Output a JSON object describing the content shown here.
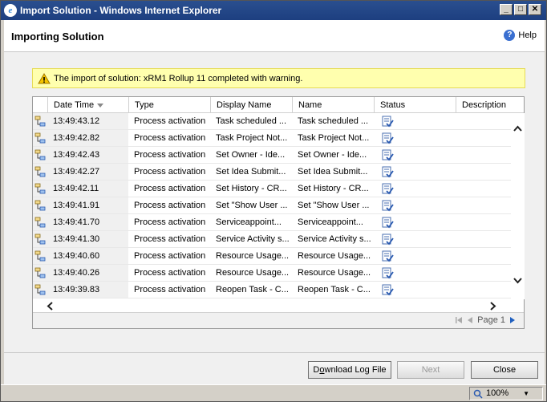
{
  "window": {
    "title": "Import Solution - Windows Internet Explorer",
    "icon": "ie-icon",
    "controls": [
      "minimize",
      "maximize",
      "close"
    ]
  },
  "header": {
    "title": "Importing Solution",
    "help_label": "Help"
  },
  "alert": {
    "message": "The import of solution: xRM1 Rollup 11 completed with warning.",
    "icon": "warning-icon"
  },
  "grid": {
    "columns": [
      "Date Time",
      "Type",
      "Display Name",
      "Name",
      "Status",
      "Description"
    ],
    "rows": [
      {
        "time": "13:49:43.12",
        "type": "Process activation",
        "display": "Task scheduled ...",
        "name": "Task scheduled ..."
      },
      {
        "time": "13:49:42.82",
        "type": "Process activation",
        "display": "Task Project Not...",
        "name": "Task Project Not..."
      },
      {
        "time": "13:49:42.43",
        "type": "Process activation",
        "display": "Set Owner - Ide...",
        "name": "Set Owner - Ide..."
      },
      {
        "time": "13:49:42.27",
        "type": "Process activation",
        "display": "Set Idea Submit...",
        "name": "Set Idea Submit..."
      },
      {
        "time": "13:49:42.11",
        "type": "Process activation",
        "display": "Set History - CR...",
        "name": "Set History - CR..."
      },
      {
        "time": "13:49:41.91",
        "type": "Process activation",
        "display": "Set \"Show User ...",
        "name": "Set \"Show User ..."
      },
      {
        "time": "13:49:41.70",
        "type": "Process activation",
        "display": "Serviceappoint...",
        "name": "Serviceappoint..."
      },
      {
        "time": "13:49:41.30",
        "type": "Process activation",
        "display": "Service Activity s...",
        "name": "Service Activity s..."
      },
      {
        "time": "13:49:40.60",
        "type": "Process activation",
        "display": "Resource Usage...",
        "name": "Resource Usage..."
      },
      {
        "time": "13:49:40.26",
        "type": "Process activation",
        "display": "Resource Usage...",
        "name": "Resource Usage..."
      },
      {
        "time": "13:49:39.83",
        "type": "Process activation",
        "display": "Reopen Task - C...",
        "name": "Reopen Task - C..."
      }
    ],
    "pager": {
      "label": "Page 1"
    }
  },
  "footer": {
    "download_label": "Download Log File",
    "download_accesskey": "o",
    "next_label": "Next",
    "close_label": "Close"
  },
  "statusbar": {
    "zoom": "100%"
  }
}
